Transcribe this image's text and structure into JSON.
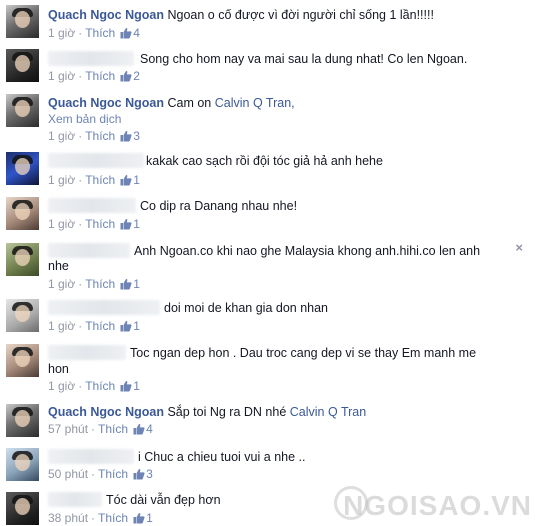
{
  "comments": [
    {
      "author": "Quach Ngoc Ngoan",
      "text": "Ngoan o cố được vì đời người chỉ sống 1 lần!!!!!",
      "time": "1 giờ",
      "like_label": "Thích",
      "likes": "4"
    },
    {
      "author": "",
      "text": "Song cho hom nay va mai sau la dung nhat! Co len Ngoan.",
      "time": "1 giờ",
      "like_label": "Thích",
      "likes": "2"
    },
    {
      "author": "Quach Ngoc Ngoan",
      "text": "Cam on",
      "mention": "Calvin Q Tran,",
      "translate": "Xem bản dịch",
      "time": "1 giờ",
      "like_label": "Thích",
      "likes": "3"
    },
    {
      "author": "",
      "text": "kakak cao sạch rồi đội tóc giả hả anh hehe",
      "time": "1 giờ",
      "like_label": "Thích",
      "likes": "1"
    },
    {
      "author": "",
      "text": "Co dip ra Danang nhau nhe!",
      "time": "1 giờ",
      "like_label": "Thích",
      "likes": "1"
    },
    {
      "author": "",
      "text": "Anh Ngoan.co khi nao ghe Malaysia khong anh.hihi.co len anh",
      "text2": "nhe",
      "close": "×",
      "time": "1 giờ",
      "like_label": "Thích",
      "likes": "1"
    },
    {
      "author": "",
      "text": "doi moi de khan gia don nhan",
      "time": "1 giờ",
      "like_label": "Thích",
      "likes": "1"
    },
    {
      "author": "",
      "text": "Toc ngan dep hon .  Dau troc cang dep vi se thay Em manh me",
      "text2": "hon",
      "time": "1 giờ",
      "like_label": "Thích",
      "likes": "1"
    },
    {
      "author": "Quach Ngoc Ngoan",
      "text": "Sắp toi Ng ra DN nhé",
      "mention": "Calvin Q Tran",
      "time": "57 phút",
      "like_label": "Thích",
      "likes": "4"
    },
    {
      "author": "",
      "text": "i Chuc a chieu tuoi vui a nhe ..",
      "time": "50 phút",
      "like_label": "Thích",
      "likes": "3"
    },
    {
      "author": "",
      "text": "Tóc dài vẫn đẹp hơn",
      "time": "38 phút",
      "like_label": "Thích",
      "likes": "1"
    }
  ],
  "watermark": "NGOISAO.VN",
  "colors": {
    "author": "#3b5998",
    "meta": "#9197a3",
    "link": "#6d84b4"
  }
}
